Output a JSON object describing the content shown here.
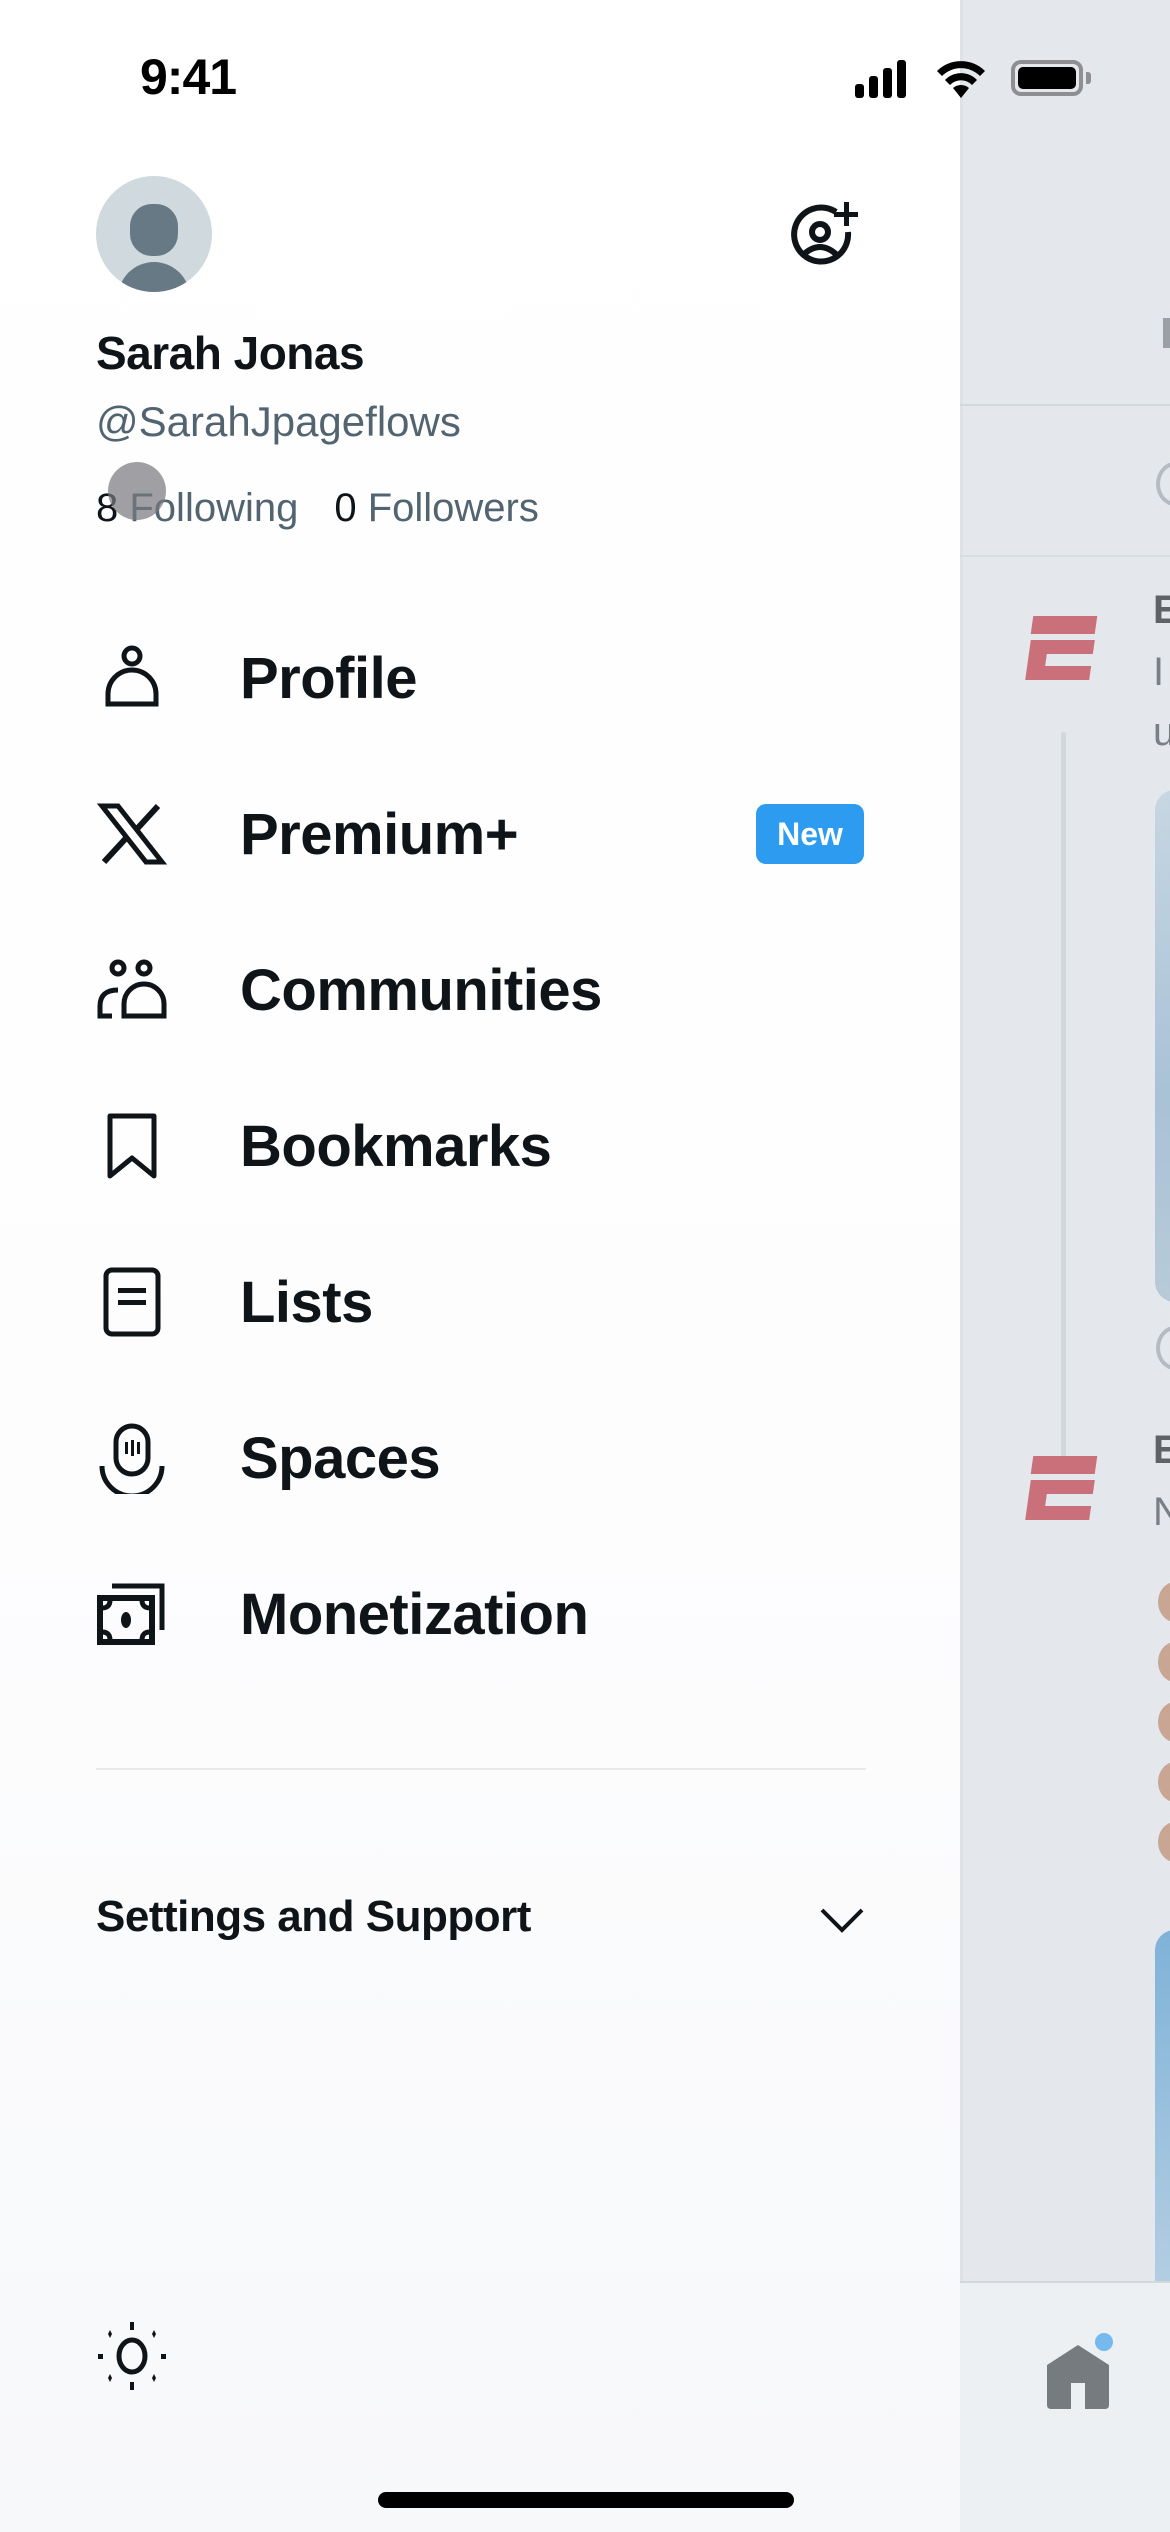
{
  "status_bar": {
    "time": "9:41",
    "icons": [
      "cellular-signal-icon",
      "wifi-icon",
      "battery-icon"
    ]
  },
  "profile": {
    "display_name": "Sarah Jonas",
    "handle": "@SarahJpageflows",
    "following_count": "8",
    "following_label": "Following",
    "followers_count": "0",
    "followers_label": "Followers",
    "add_account_icon": "add-account-icon"
  },
  "menu": {
    "items": [
      {
        "label": "Profile",
        "icon": "person-icon"
      },
      {
        "label": "Premium+",
        "icon": "x-logo-icon",
        "badge": "New"
      },
      {
        "label": "Communities",
        "icon": "communities-icon"
      },
      {
        "label": "Bookmarks",
        "icon": "bookmark-icon"
      },
      {
        "label": "Lists",
        "icon": "lists-icon"
      },
      {
        "label": "Spaces",
        "icon": "spaces-icon"
      },
      {
        "label": "Monetization",
        "icon": "monetization-icon"
      }
    ]
  },
  "settings": {
    "label": "Settings and Support",
    "expand_icon": "chevron-down-icon"
  },
  "footer": {
    "theme_icon": "sun-icon"
  },
  "background_feed": {
    "posts": [
      {
        "author_initial": "E",
        "line1": "I",
        "line2": "u",
        "logo": "espn-logo"
      },
      {
        "author_initial": "E",
        "line1": "N",
        "logo": "espn-logo"
      }
    ],
    "tab_bar": {
      "home_icon": "home-icon",
      "has_notification_dot": true
    }
  },
  "colors": {
    "accent_blue": "#2d9bf0",
    "text_primary": "#0f1419",
    "text_secondary": "#536471",
    "espn_red": "#c9707a"
  }
}
